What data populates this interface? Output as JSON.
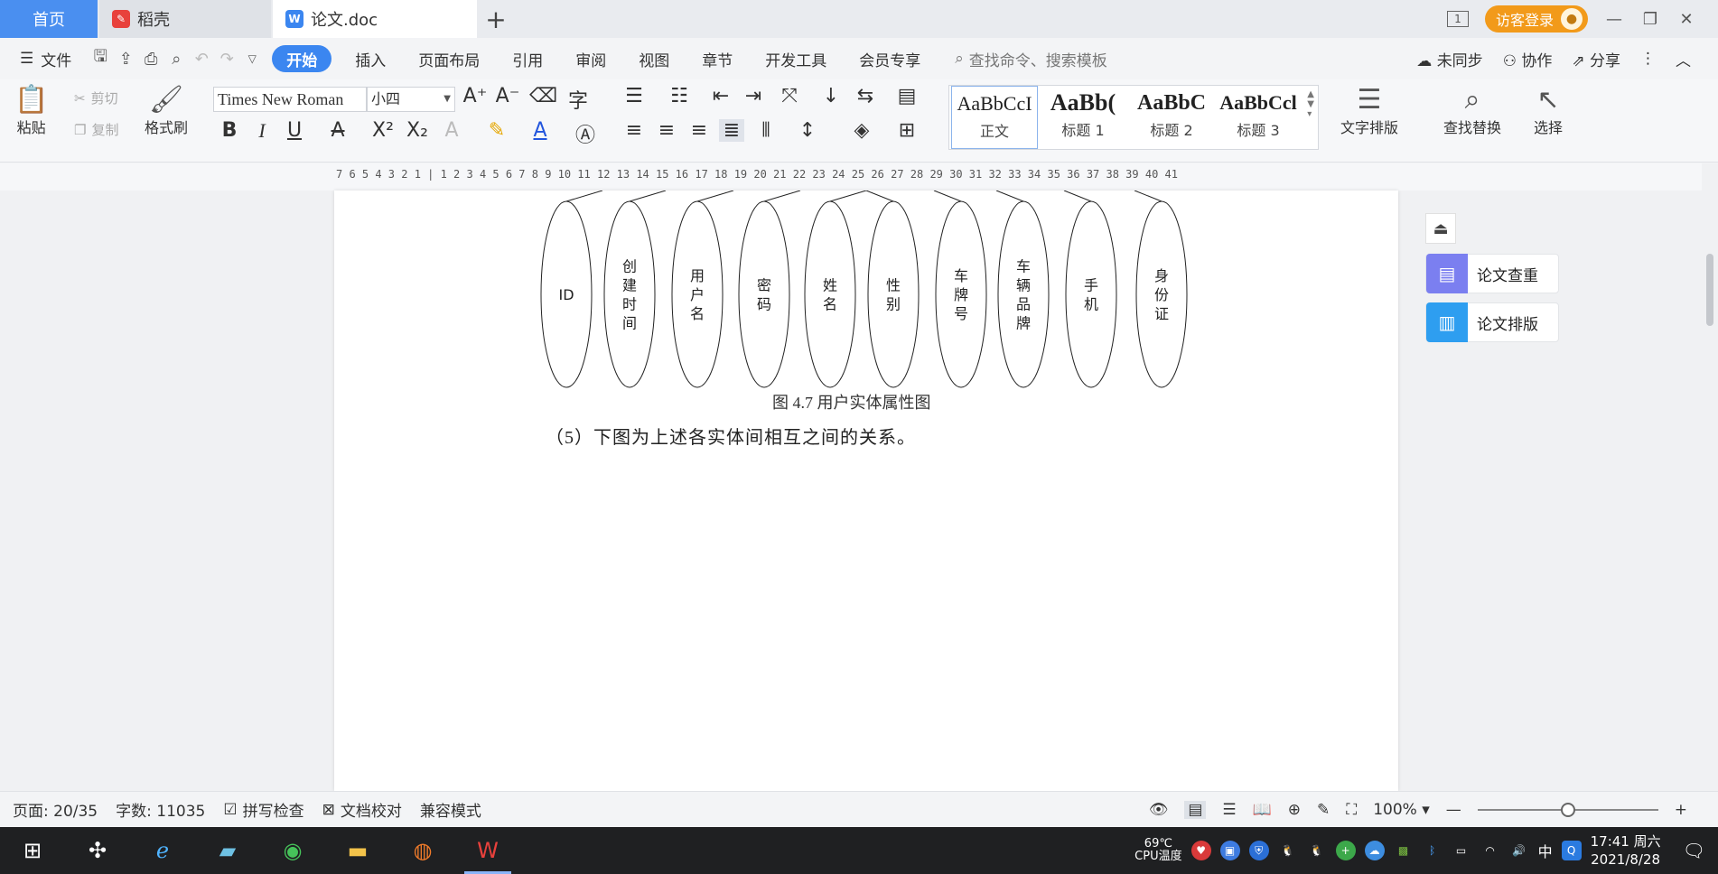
{
  "tabs": {
    "home": "首页",
    "docshell": "稻壳",
    "active_doc": "论文.doc",
    "new_tab": "+"
  },
  "window": {
    "visitor_login": "访客登录",
    "page_badge": "1"
  },
  "menu": {
    "file": "文件",
    "items": [
      "开始",
      "插入",
      "页面布局",
      "引用",
      "审阅",
      "视图",
      "章节",
      "开发工具",
      "会员专享"
    ],
    "search_placeholder": "查找命令、搜索模板",
    "unsynced": "未同步",
    "collaborate": "协作",
    "share": "分享"
  },
  "ribbon": {
    "paste": "粘贴",
    "cut": "剪切",
    "copy": "复制",
    "format_painter": "格式刷",
    "font_name": "Times New Roman",
    "font_size": "小四",
    "styles": [
      {
        "preview": "AaBbCcI",
        "name": "正文"
      },
      {
        "preview": "AaBb(",
        "name": "标题 1"
      },
      {
        "preview": "AaBbC",
        "name": "标题 2"
      },
      {
        "preview": "AaBbCcl",
        "name": "标题 3"
      }
    ],
    "text_layout": "文字排版",
    "find_replace": "查找替换",
    "select": "选择"
  },
  "ruler": {
    "numbers": "7  6  5  4  3  2  1  |  1  2  3  4  5  6  7  8  9  10 11 12 13 14 15 16 17 18 19 20 21 22 23 24 25 26 27 28 29 30 31 32 33 34 35 36 37 38 39 40 41"
  },
  "document": {
    "attributes": [
      "ID",
      "创\n建\n时\n间",
      "用\n户\n名",
      "密\n码",
      "姓\n名",
      "性\n别",
      "车\n牌\n号",
      "车\n辆\n品\n牌",
      "手\n机",
      "身\n份\n证"
    ],
    "caption": "图 4.7  用户实体属性图",
    "paragraph": "（5）下图为上述各实体间相互之间的关系。"
  },
  "side_panel": {
    "check": "论文查重",
    "layout": "论文排版"
  },
  "status": {
    "page": "页面: 20/35",
    "words": "字数: 11035",
    "spell": "拼写检查",
    "proof": "文档校对",
    "compat": "兼容模式",
    "zoom": "100%",
    "zoom_fraction": 0.5
  },
  "taskbar": {
    "cpu_temp": "69℃",
    "cpu_label": "CPU温度",
    "ime": "中",
    "time": "17:41 周六",
    "date": "2021/8/28"
  },
  "colors": {
    "accent": "#3b86f0",
    "home_tab": "#4a8ff0",
    "visitor": "#f29a1a",
    "wps_red": "#e8413c",
    "side_check": "#7b7ff0",
    "side_layout": "#2e9ef0"
  }
}
